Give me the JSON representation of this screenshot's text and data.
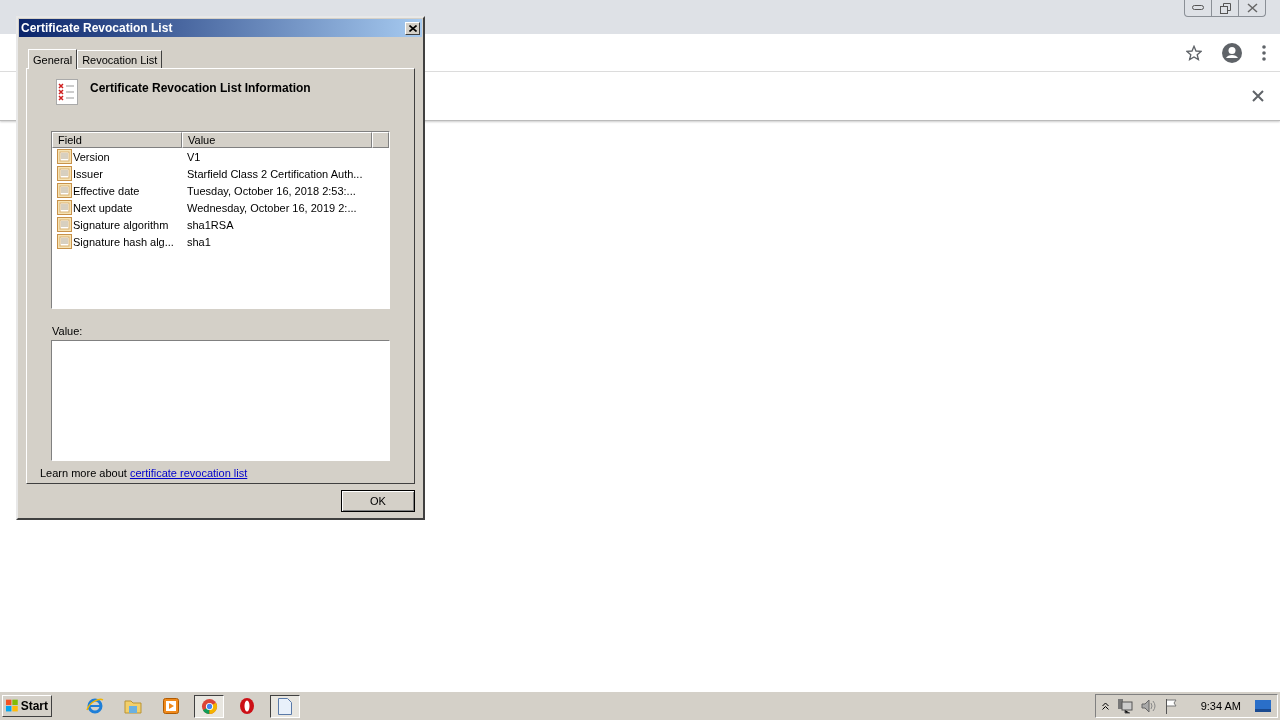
{
  "dialog": {
    "title": "Certificate Revocation List",
    "tabs": [
      {
        "label": "General",
        "selected": true
      },
      {
        "label": "Revocation List",
        "selected": false
      }
    ],
    "heading": "Certificate Revocation List Information",
    "list": {
      "columns": [
        "Field",
        "Value"
      ],
      "rows": [
        {
          "field": "Version",
          "value": "V1"
        },
        {
          "field": "Issuer",
          "value": "Starfield Class 2 Certification Auth..."
        },
        {
          "field": "Effective date",
          "value": "Tuesday, October 16, 2018 2:53:..."
        },
        {
          "field": "Next update",
          "value": "Wednesday, October 16, 2019 2:..."
        },
        {
          "field": "Signature algorithm",
          "value": "sha1RSA"
        },
        {
          "field": "Signature hash alg...",
          "value": "sha1"
        }
      ]
    },
    "value_label": "Value:",
    "learn_more": {
      "text": "Learn more about",
      "link": "certificate revocation list"
    },
    "buttons": [
      "OK"
    ]
  },
  "taskbar": {
    "start": "Start",
    "apps": [
      {
        "kind": "ie",
        "active": false
      },
      {
        "kind": "folder",
        "active": false
      },
      {
        "kind": "media",
        "active": false
      },
      {
        "kind": "chrome",
        "active": true
      },
      {
        "kind": "opera",
        "active": false
      },
      {
        "kind": "document",
        "active": true
      }
    ],
    "clock": "9:34 AM"
  }
}
